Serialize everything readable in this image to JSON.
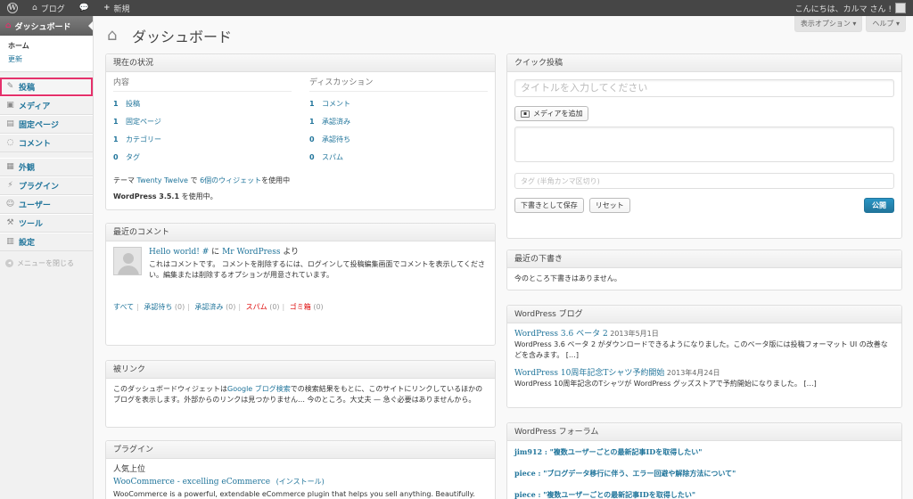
{
  "adminbar": {
    "blog_label": "ブログ",
    "new_label": "新規",
    "greeting": "こんにちは、カルマ さん !"
  },
  "sidebar": {
    "dashboard": "ダッシュボード",
    "submenu": [
      "ホーム",
      "更新"
    ],
    "items": [
      {
        "label": "投稿",
        "icon": "pin-icon"
      },
      {
        "label": "メディア",
        "icon": "media-icon"
      },
      {
        "label": "固定ページ",
        "icon": "pages-icon"
      },
      {
        "label": "コメント",
        "icon": "comment-icon"
      },
      {
        "label": "外観",
        "icon": "appearance-icon"
      },
      {
        "label": "プラグイン",
        "icon": "plugin-icon"
      },
      {
        "label": "ユーザー",
        "icon": "users-icon"
      },
      {
        "label": "ツール",
        "icon": "tools-icon"
      },
      {
        "label": "設定",
        "icon": "settings-icon"
      }
    ],
    "collapse": "メニューを閉じる",
    "highlight_color": "#e5316b"
  },
  "header": {
    "title": "ダッシュボード",
    "screen_options": "表示オプション ▾",
    "help": "ヘルプ ▾"
  },
  "right_now": {
    "title": "現在の状況",
    "content_head": "内容",
    "discussion_head": "ディスカッション",
    "content": [
      {
        "num": "1",
        "label": "投稿"
      },
      {
        "num": "1",
        "label": "固定ページ"
      },
      {
        "num": "1",
        "label": "カテゴリー"
      },
      {
        "num": "0",
        "label": "タグ"
      }
    ],
    "discussion": [
      {
        "num": "1",
        "label": "コメント"
      },
      {
        "num": "1",
        "label": "承認済み"
      },
      {
        "num": "0",
        "label": "承認待ち"
      },
      {
        "num": "0",
        "label": "スパム"
      }
    ],
    "theme_prefix": "テーマ",
    "theme_name": "Twenty Twelve",
    "theme_mid": "で",
    "widgets": "6個のウィジェット",
    "theme_suffix": "を使用中",
    "version_bold": "WordPress 3.5.1",
    "version_suffix": "を使用中。"
  },
  "recent_comments": {
    "title": "最近のコメント",
    "post": "Hello world! #",
    "by": "に",
    "author": "Mr WordPress",
    "from": "より",
    "text": "これはコメントです。 コメントを削除するには、ログインして投稿編集画面でコメントを表示してください。編集または削除するオプションが用意されています。",
    "links": [
      {
        "label": "すべて",
        "count": ""
      },
      {
        "label": "承認待ち",
        "count": "(0)"
      },
      {
        "label": "承認済み",
        "count": "(0)"
      },
      {
        "label": "スパム",
        "count": "(0)"
      },
      {
        "label": "ゴミ箱",
        "count": "(0)"
      }
    ]
  },
  "incoming_links": {
    "title": "被リンク",
    "text_pre": "このダッシュボードウィジェットは",
    "link": "Google ブログ検索",
    "text_post": "での検索結果をもとに、このサイトにリンクしているほかのブログを表示します。外部からのリンクは見つかりません… 今のところ。大丈夫 — 急ぐ必要はありませんから。"
  },
  "plugins": {
    "title": "プラグイン",
    "popular": "人気上位",
    "plugin_name": "WooCommerce - excelling eCommerce",
    "install": "(インストール)",
    "desc": "WooCommerce is a powerful, extendable eCommerce plugin that helps you sell anything. Beautifully."
  },
  "quick_press": {
    "title": "クイック投稿",
    "title_placeholder": "タイトルを入力してください",
    "add_media": "メディアを追加",
    "tags_placeholder": "タグ (半角カンマ区切り)",
    "save_draft": "下書きとして保存",
    "reset": "リセット",
    "publish": "公開"
  },
  "recent_drafts": {
    "title": "最近の下書き",
    "empty": "今のところ下書きはありません。"
  },
  "wp_blog": {
    "title": "WordPress ブログ",
    "items": [
      {
        "title": "WordPress 3.6 ベータ 2",
        "date": "2013年5月1日",
        "text": "WordPress 3.6 ベータ 2 がダウンロードできるようになりました。このベータ版には投稿フォーマット UI の改善などを含みます。 […]"
      },
      {
        "title": "WordPress 10周年記念Tシャツ予約開始",
        "date": "2013年4月24日",
        "text": "WordPress 10周年記念のTシャツが WordPress グッズストアで予約開始になりました。 […]"
      }
    ]
  },
  "wp_forum": {
    "title": "WordPress フォーラム",
    "items": [
      "jim912 : \"複数ユーザーごとの最新記事IDを取得したい\"",
      "piece : \"ブログデータ移行に伴う、エラー回避や解除方法について\"",
      "piece : \"複数ユーザーごとの最新記事IDを取得したい\""
    ]
  }
}
